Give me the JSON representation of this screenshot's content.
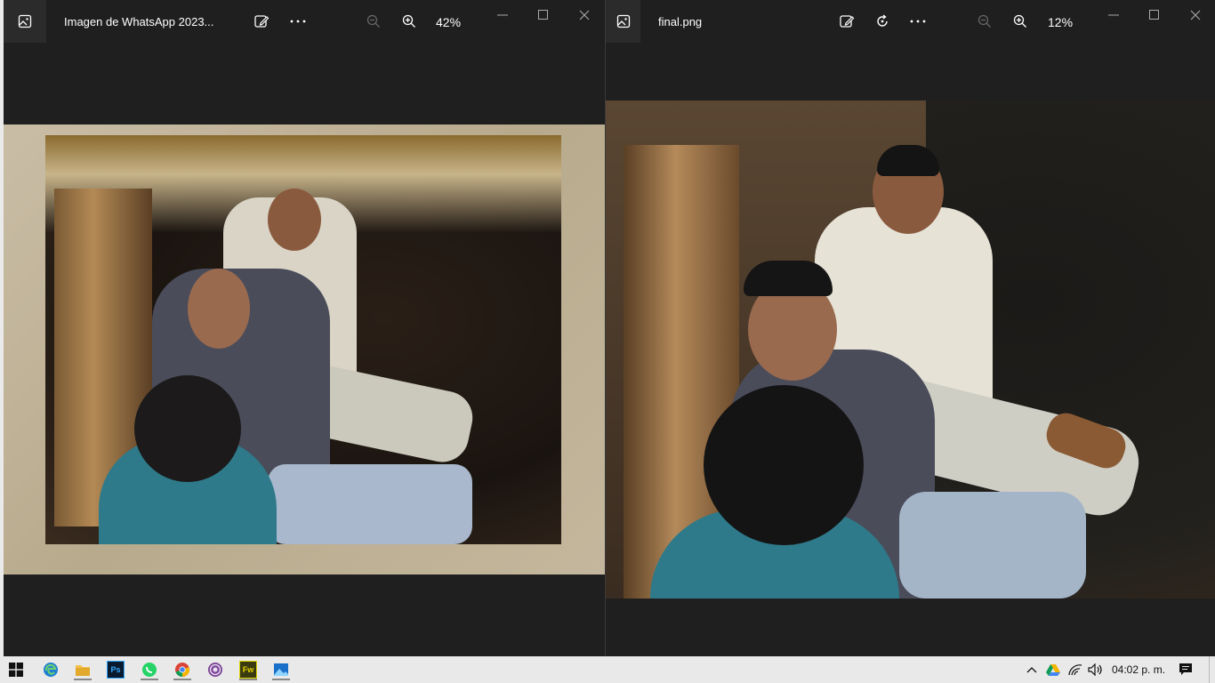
{
  "left_window": {
    "title": "Imagen de WhatsApp 2023...",
    "zoom": "42%",
    "icons": [
      "photos-app-icon",
      "edit-image-icon",
      "more-icon",
      "zoom-out-icon",
      "zoom-in-icon",
      "minimize-icon",
      "maximize-icon",
      "close-icon"
    ]
  },
  "right_window": {
    "title": "final.png",
    "zoom": "12%",
    "icons": [
      "photos-app-icon",
      "edit-image-icon",
      "rotate-icon",
      "more-icon",
      "zoom-out-icon",
      "zoom-in-icon",
      "minimize-icon",
      "maximize-icon",
      "close-icon"
    ]
  },
  "taskbar": {
    "apps": [
      "windows-start-icon",
      "edge-icon",
      "file-explorer-icon",
      "photoshop-icon",
      "whatsapp-icon",
      "chrome-icon",
      "tor-browser-icon",
      "fireworks-icon",
      "photos-icon"
    ],
    "photoshop_label": "Ps",
    "fireworks_label": "Fw",
    "tray_icons": [
      "chevron-up-icon",
      "google-drive-icon",
      "wifi-icon",
      "volume-icon",
      "notifications-icon"
    ],
    "clock": "04:02 p. m."
  }
}
